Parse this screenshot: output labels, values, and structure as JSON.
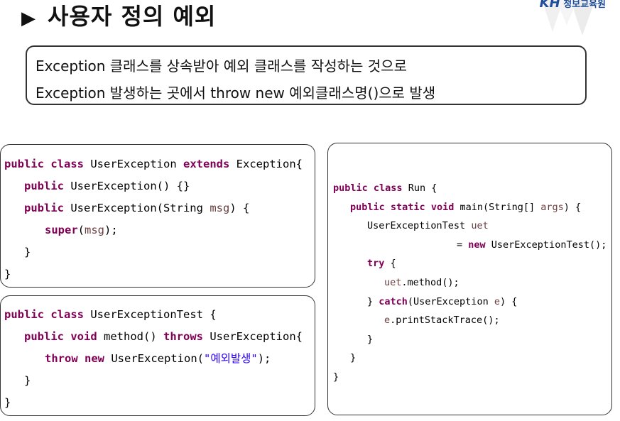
{
  "slide": {
    "title": "사용자 정의 예외",
    "logo_kh": "KH",
    "logo_text": "정보교육원"
  },
  "description": {
    "line1": "Exception 클래스를 상속받아 예외 클래스를 작성하는 것으로",
    "line2": "Exception 발생하는 곳에서 throw new 예외클래스명()으로 발생"
  },
  "code": {
    "user_exception": {
      "l1": [
        "public",
        " ",
        "class",
        " UserException ",
        "extends",
        " Exception{"
      ],
      "l2": [
        "public",
        " UserException() {}"
      ],
      "l3": [
        "public",
        " UserException(String ",
        "msg",
        ") {"
      ],
      "l4": [
        "super",
        "(",
        "msg",
        ");"
      ],
      "l5": "}",
      "l6": "}"
    },
    "user_exception_test": {
      "l1": [
        "public",
        " ",
        "class",
        " UserExceptionTest {"
      ],
      "l2": [
        "public",
        " ",
        "void",
        " method() ",
        "throws",
        " UserException{"
      ],
      "l3": [
        "throw",
        " ",
        "new",
        " UserException(",
        "\"예외발생\"",
        ");"
      ],
      "l4": "}",
      "l5": "}"
    },
    "run": {
      "l1": [
        "public",
        " ",
        "class",
        " Run {"
      ],
      "l2": [
        "public",
        " ",
        "static",
        " ",
        "void",
        " main(String[] ",
        "args",
        ") {"
      ],
      "l3": [
        "UserExceptionTest ",
        "uet"
      ],
      "l4": [
        "= ",
        "new",
        " UserExceptionTest();"
      ],
      "l5": [
        "try",
        " {"
      ],
      "l6": [
        "uet",
        ".method();"
      ],
      "l7": [
        "} ",
        "catch",
        "(UserException ",
        "e",
        ") {"
      ],
      "l8": [
        "e",
        ".printStackTrace();"
      ],
      "l9": "}",
      "l10": "}",
      "l11": "}"
    }
  }
}
